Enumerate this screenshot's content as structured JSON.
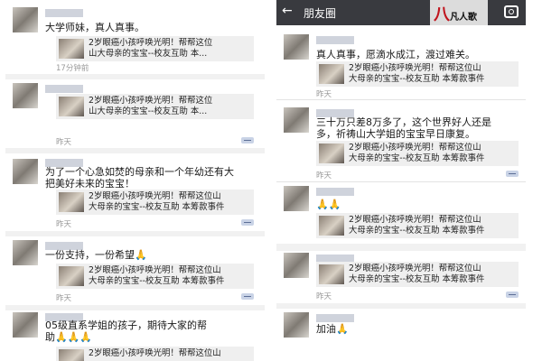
{
  "left": {
    "posts": [
      {
        "text": "大学师妹，真人真事。",
        "card": [
          "2岁眼癌小孩呼唤光明！帮帮这位",
          "山大母亲的宝宝--校友互助 本..."
        ],
        "time": "17分钟前"
      },
      {
        "text": "",
        "card": [
          "2岁眼癌小孩呼唤光明！帮帮这位",
          "山大母亲的宝宝--校友互助 本..."
        ],
        "time": "昨天"
      },
      {
        "text": "为了一个心急如焚的母亲和一个年幼还有大",
        "text2": "把美好未来的宝宝！",
        "card": [
          "2岁眼癌小孩呼唤光明！帮帮这位山",
          "大母亲的宝宝--校友互助 本筹款事件"
        ],
        "time": "昨天"
      },
      {
        "text": "一份支持，一份希望🙏",
        "card": [
          "2岁眼癌小孩呼唤光明！帮帮这位山",
          "大母亲的宝宝--校友互助 本筹款事件"
        ],
        "time": "昨天"
      },
      {
        "text": "05级直系学姐的孩子，期待大家的帮",
        "text2": "助🙏🙏🙏",
        "card": [
          "2岁眼癌小孩呼唤光明！帮帮这位山",
          ""
        ],
        "time": ""
      }
    ]
  },
  "right": {
    "header": {
      "back_icon": "←",
      "title": "朋友圈",
      "logo_mark": "八",
      "logo_text": "凡人歌",
      "camera_icon": "camera-icon"
    },
    "posts": [
      {
        "text": "真人真事，愿滴水成江，渡过难关。",
        "card": [
          "2岁眼癌小孩呼唤光明！帮帮这位山",
          "大母亲的宝宝--校友互助 本筹款事件"
        ],
        "time": "昨天"
      },
      {
        "text": "三十万只差8万多了，这个世界好人还是",
        "text2": "多，祈祷山大学姐的宝宝早日康复。",
        "card": [
          "2岁眼癌小孩呼唤光明！帮帮这位山",
          "大母亲的宝宝--校友互助 本筹款事件"
        ],
        "time": "昨天"
      },
      {
        "text": "🙏🙏",
        "card": [
          "2岁眼癌小孩呼唤光明！帮帮这位山",
          "大母亲的宝宝--校友互助 本筹款事件"
        ],
        "time": ""
      },
      {
        "text": "",
        "card": [
          "2岁眼癌小孩呼唤光明！帮帮这位山",
          "大母亲的宝宝--校友互助 本筹款事件"
        ],
        "time": "昨天"
      },
      {
        "text": "加油🙏",
        "card": [
          "",
          ""
        ],
        "time": ""
      }
    ]
  }
}
